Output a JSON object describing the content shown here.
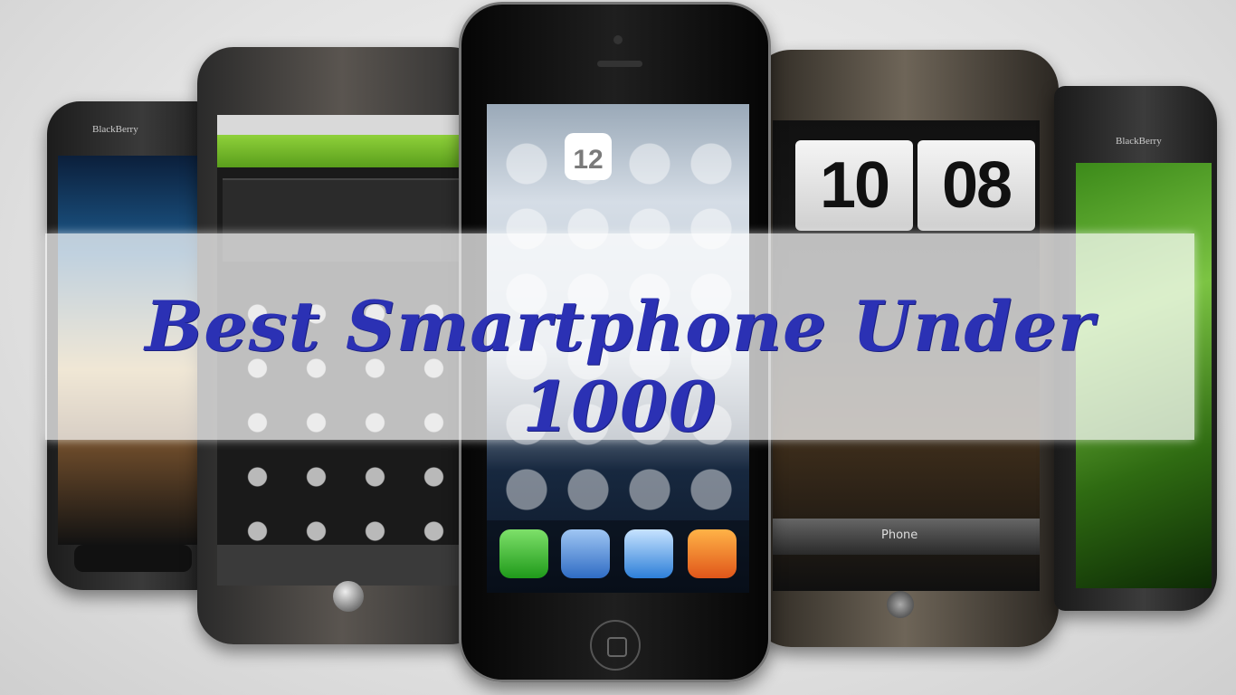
{
  "title": "Best Smartphone Under 1000",
  "phones": {
    "bb_left_brand": "BlackBerry",
    "bb_right_brand": "BlackBerry",
    "htc_clock_hour": "10",
    "htc_clock_min": "08",
    "htc_dock_label": "Phone",
    "iphone_calendar_date": "12"
  },
  "colors": {
    "title": "#2b31b4",
    "band": "#ffffff",
    "android_green": "#7cc443"
  },
  "icons": [
    "phone-icon",
    "mail-icon",
    "safari-icon",
    "music-icon"
  ]
}
